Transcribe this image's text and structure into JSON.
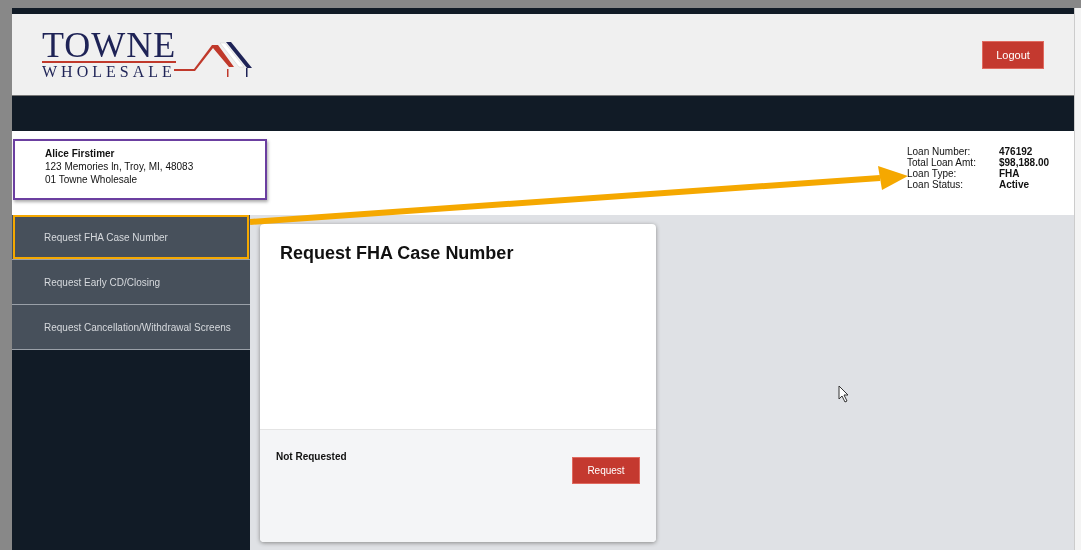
{
  "header": {
    "logo": {
      "title": "TOWNE",
      "subtitle": "WHOLESALE"
    },
    "logout_button": "Logout"
  },
  "borrower": {
    "name": "Alice Firstimer",
    "address": "123 Memories ln, Troy, MI, 48083",
    "company": "01 Towne Wholesale"
  },
  "loan_info": [
    {
      "label": "Loan Number:",
      "value": "476192"
    },
    {
      "label": "Total Loan Amt:",
      "value": "$98,188.00"
    },
    {
      "label": "Loan Type:",
      "value": "FHA"
    },
    {
      "label": "Loan Status:",
      "value": "Active"
    }
  ],
  "sidebar": {
    "items": [
      {
        "label": "Request FHA Case Number"
      },
      {
        "label": "Request Early CD/Closing"
      },
      {
        "label": "Request Cancellation/Withdrawal Screens"
      }
    ]
  },
  "card": {
    "title": "Request FHA Case Number",
    "status": "Not Requested",
    "button": "Request"
  }
}
